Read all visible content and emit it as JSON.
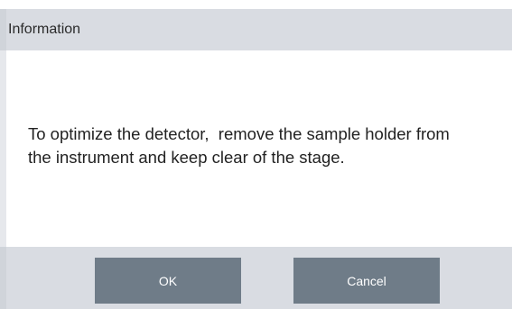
{
  "dialog": {
    "title": "Information",
    "message_line1": "To optimize the detector,  remove the sample holder from",
    "message_line2": "the instrument and keep clear of the stage.",
    "buttons": {
      "ok_label": "OK",
      "cancel_label": "Cancel"
    }
  },
  "colors": {
    "title_bar": "#d9dce2",
    "footer": "#d9dce2",
    "button": "#6f7c88",
    "button_text": "#ffffff",
    "body": "#ffffff"
  }
}
